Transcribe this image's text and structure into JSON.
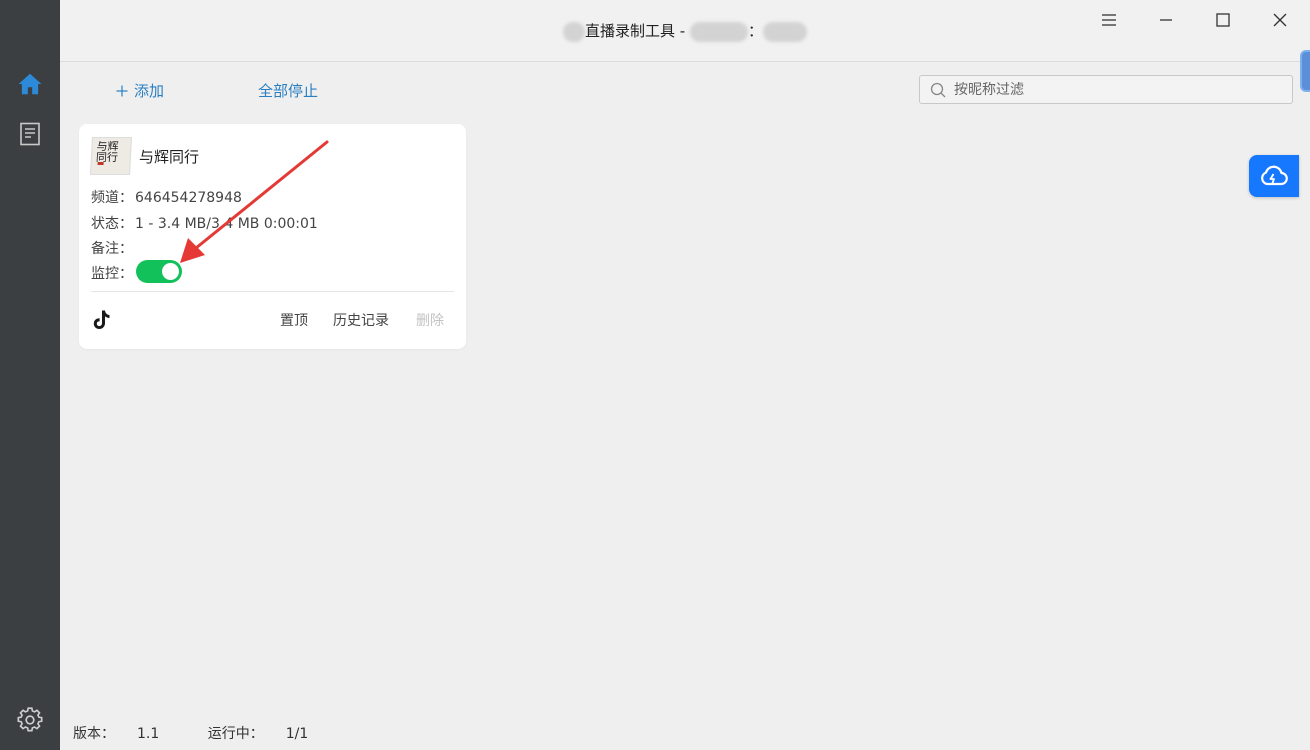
{
  "window": {
    "title_main": "直播录制工具 - ",
    "title_sep": "："
  },
  "toolbar": {
    "add_label": "添加",
    "stop_all_label": "全部停止",
    "search_placeholder": "按昵称过滤"
  },
  "sidebar": {
    "items": [
      {
        "icon": "home-icon",
        "active": true
      },
      {
        "icon": "document-icon",
        "active": false
      }
    ],
    "bottom_icon": "settings-icon"
  },
  "card": {
    "avatar_text": "与辉同行",
    "name": "与辉同行",
    "channel_label": "频道：",
    "channel_value": "646454278948",
    "status_label": "状态：",
    "status_value": "1 - 3.4 MB/3.4 MB 0:00:01",
    "note_label": "备注：",
    "note_value": "",
    "monitor_label": "监控：",
    "monitor_on": true,
    "platform_icon": "tiktok-icon",
    "actions": {
      "pin": "置顶",
      "history": "历史记录",
      "delete": "删除"
    }
  },
  "status_bar": {
    "version_label": "版本：",
    "version_value": "1.1",
    "running_label": "运行中：",
    "running_value": "1/1"
  },
  "colors": {
    "sidebar_bg": "#3c3f41",
    "accent_blue": "#2a7fc0",
    "home_icon": "#2d8ad8",
    "toggle_on": "#13c15a",
    "cloud_button": "#1677ff",
    "arrow": "#e53935"
  }
}
